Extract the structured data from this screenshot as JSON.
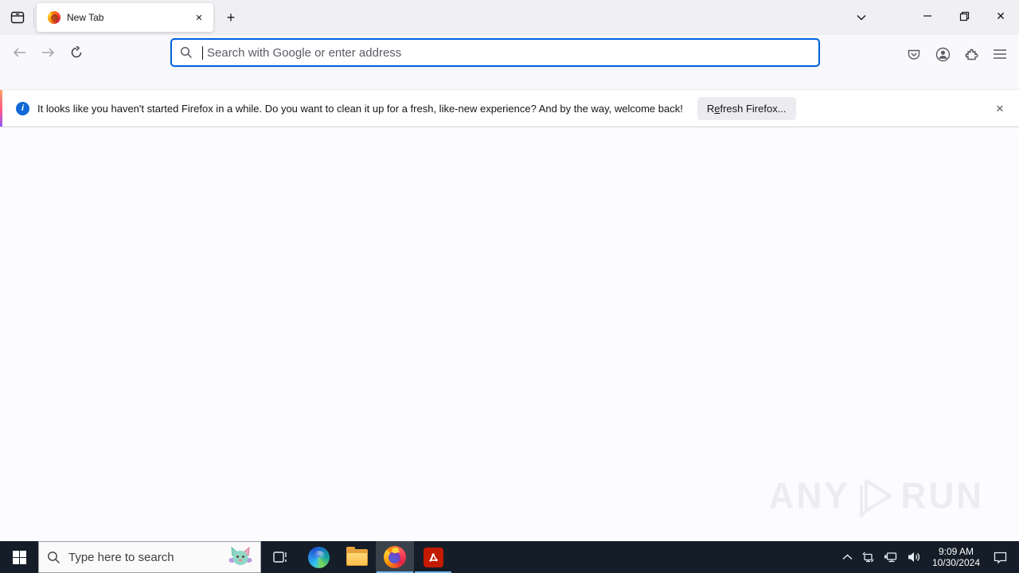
{
  "browser": {
    "tab": {
      "title": "New Tab"
    },
    "address_bar": {
      "placeholder": "Search with Google or enter address"
    },
    "notification": {
      "message": "It looks like you haven't started Firefox in a while. Do you want to clean it up for a fresh, like-new experience? And by the way, welcome back!",
      "button": {
        "pre": "R",
        "accesskey": "e",
        "post": "fresh Firefox..."
      }
    }
  },
  "content": {
    "watermark": {
      "word1": "ANY",
      "word2": "RUN"
    }
  },
  "taskbar": {
    "search_placeholder": "Type here to search",
    "clock": {
      "time": "9:09 AM",
      "date": "10/30/2024"
    }
  },
  "icons": {
    "close": "✕",
    "plus": "+",
    "info": "i"
  },
  "colors": {
    "accent_focus": "#0062e0",
    "taskbar_bg": "#141d28",
    "app_underline": "#76b9ed",
    "notification_stripe": "linear orange-pink-purple"
  }
}
